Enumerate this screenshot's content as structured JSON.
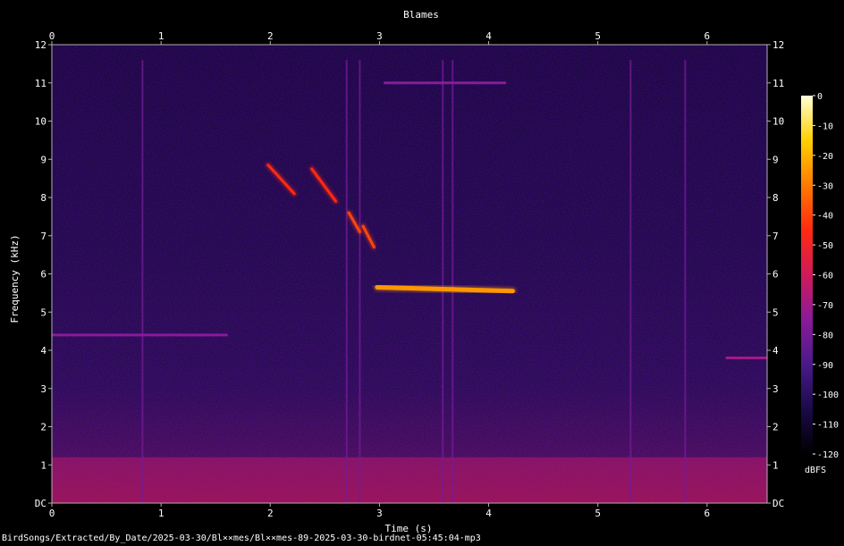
{
  "chart_data": {
    "type": "heatmap",
    "title": "Blames",
    "xlabel": "Time (s)",
    "ylabel": "Frequency (kHz)",
    "xlim": [
      0,
      6.55
    ],
    "ylim": [
      0,
      12
    ],
    "x_ticks": [
      "0",
      "1",
      "2",
      "3",
      "4",
      "5",
      "6"
    ],
    "x_tick_values": [
      0,
      1,
      2,
      3,
      4,
      5,
      6
    ],
    "y_ticks": [
      "DC",
      "1",
      "2",
      "3",
      "4",
      "5",
      "6",
      "7",
      "8",
      "9",
      "10",
      "11",
      "12"
    ],
    "y_tick_values": [
      0,
      1,
      2,
      3,
      4,
      5,
      6,
      7,
      8,
      9,
      10,
      11,
      12
    ],
    "colorbar": {
      "unit": "dBFS",
      "ticks": [
        "0",
        "-10",
        "-20",
        "-30",
        "-40",
        "-50",
        "-60",
        "-70",
        "-80",
        "-90",
        "-100",
        "-110",
        "-120"
      ],
      "tick_values": [
        0,
        -10,
        -20,
        -30,
        -40,
        -50,
        -60,
        -70,
        -80,
        -90,
        -100,
        -110,
        -120
      ],
      "range": [
        -120,
        0
      ],
      "colors": [
        "#000000",
        "#1a0a4a",
        "#4a1a8a",
        "#8a1a9a",
        "#d01a5a",
        "#ff2a10",
        "#ff7a00",
        "#ffd000",
        "#ffffd8"
      ]
    },
    "background_level_dbfs": -95,
    "low_frequency_energy": {
      "freq_range_khz": [
        0,
        1.2
      ],
      "level_dbfs": -65
    },
    "features": [
      {
        "name": "descending chirp",
        "t": [
          1.98,
          2.22
        ],
        "f": [
          8.85,
          8.1
        ],
        "level_dbfs": -45
      },
      {
        "name": "descending chirp",
        "t": [
          2.38,
          2.6
        ],
        "f": [
          8.75,
          7.9
        ],
        "level_dbfs": -45
      },
      {
        "name": "descending chirp",
        "t": [
          2.72,
          2.82
        ],
        "f": [
          7.6,
          7.1
        ],
        "level_dbfs": -40
      },
      {
        "name": "descending chirp",
        "t": [
          2.85,
          2.95
        ],
        "f": [
          7.25,
          6.7
        ],
        "level_dbfs": -40
      },
      {
        "name": "trill",
        "t": [
          2.98,
          4.22
        ],
        "f": [
          5.65,
          5.55
        ],
        "level_dbfs": -25
      },
      {
        "name": "high tone",
        "t": [
          3.05,
          4.15
        ],
        "f": [
          11.0,
          11.0
        ],
        "level_dbfs": -75
      },
      {
        "name": "low tone",
        "t": [
          0.0,
          1.6
        ],
        "f": [
          4.4,
          4.4
        ],
        "level_dbfs": -75
      },
      {
        "name": "low tone",
        "t": [
          6.18,
          6.55
        ],
        "f": [
          3.8,
          3.8
        ],
        "level_dbfs": -70
      }
    ],
    "broadband_clicks_s": [
      0.83,
      2.7,
      2.82,
      3.58,
      3.67,
      5.3,
      5.8
    ]
  },
  "footer": {
    "file_path": "BirdSongs/Extracted/By_Date/2025-03-30/Bl××mes/Bl××mes-89-2025-03-30-birdnet-05:45:04·mp3"
  }
}
